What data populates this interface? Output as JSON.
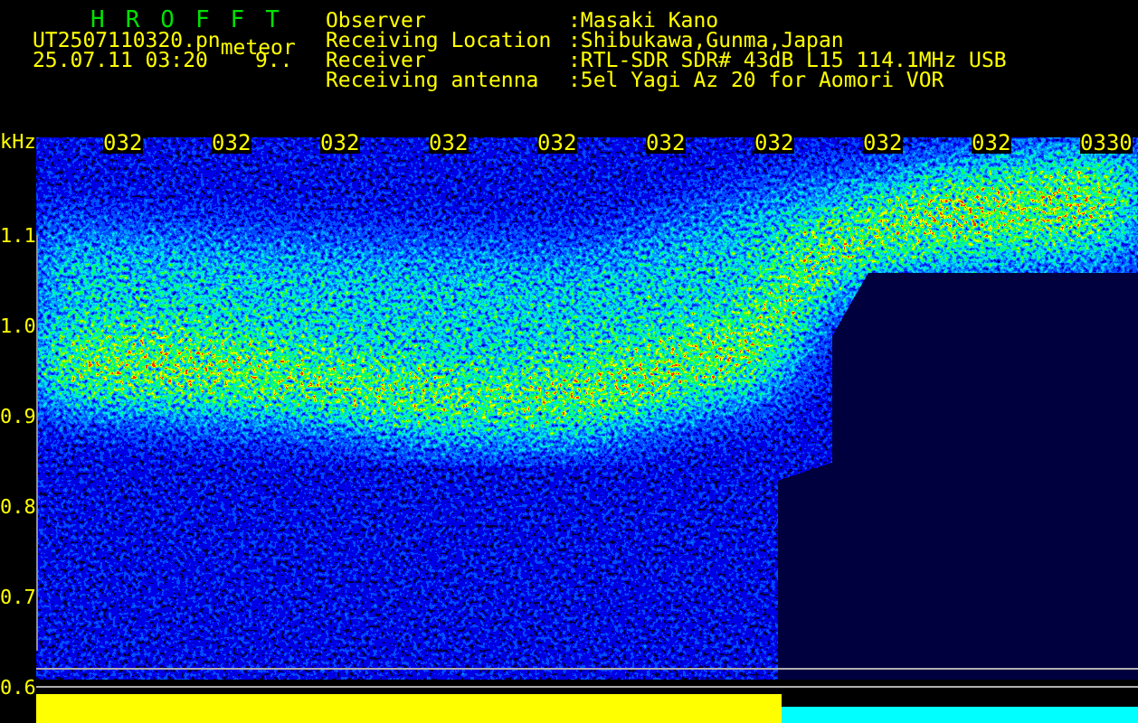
{
  "app": {
    "title": "HROFFT"
  },
  "file": {
    "name": "UT2507110320.pn",
    "label": "meteor",
    "timestamp": "25.07.11 03:20",
    "value": "9.."
  },
  "info": [
    {
      "label": "Observer",
      "value": ":Masaki Kano"
    },
    {
      "label": "Receiving Location",
      "value": ":Shibukawa,Gunma,Japan"
    },
    {
      "label": "Receiver",
      "value": ":RTL-SDR SDR# 43dB L15 114.1MHz USB"
    },
    {
      "label": "Receiving antenna",
      "value": ":5el Yagi Az 20 for Aomori VOR"
    }
  ],
  "spectrogram": {
    "y_unit": "kHz",
    "y_ticks": [
      "1.1",
      "1.0",
      "0.9",
      "0.8",
      "0.7",
      "0.6"
    ],
    "time_labels": [
      "032",
      "032",
      "032",
      "032",
      "032",
      "032",
      "032",
      "032",
      "032",
      "0330"
    ]
  }
}
